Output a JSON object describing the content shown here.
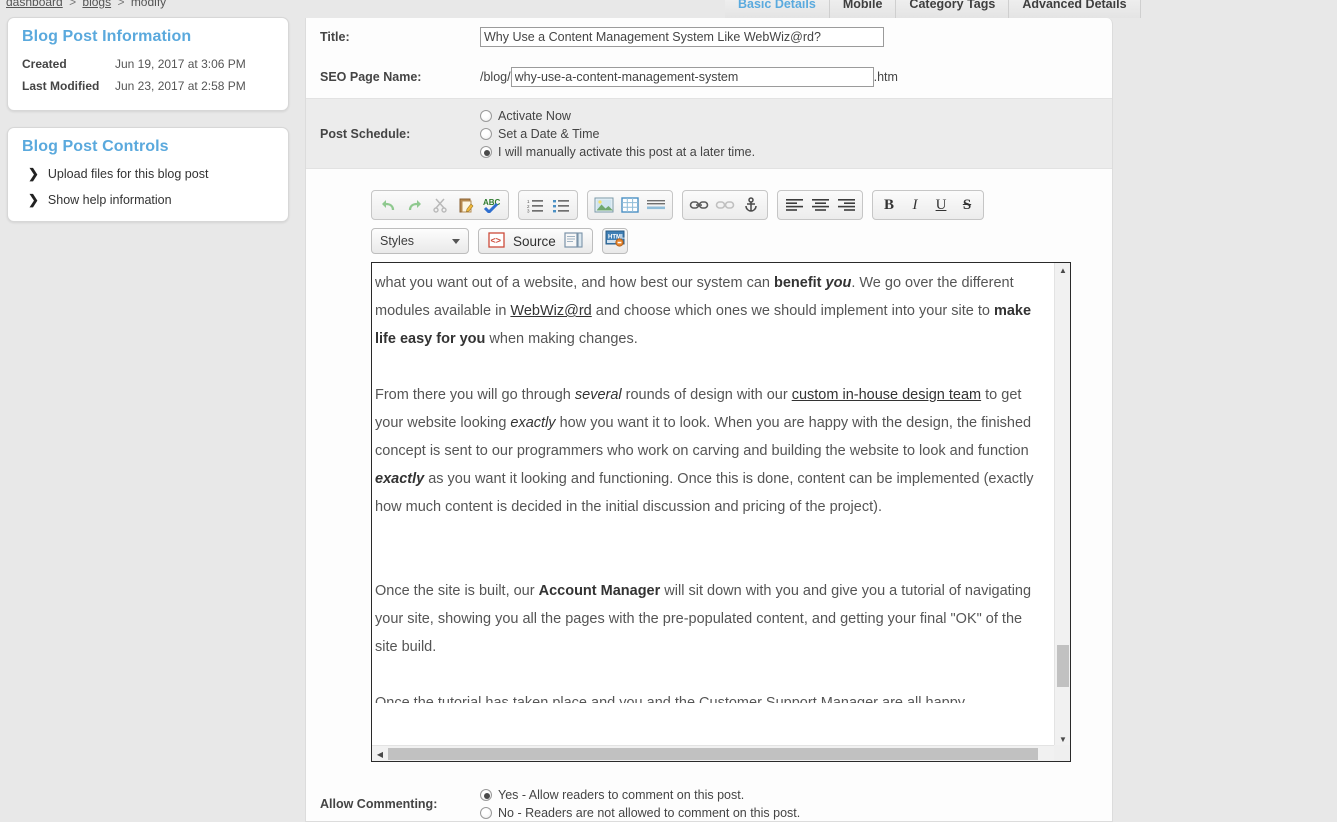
{
  "breadcrumb": {
    "items": [
      {
        "label": "dashboard",
        "link": true
      },
      {
        "label": "blogs",
        "link": true
      },
      {
        "label": "modify",
        "link": false
      }
    ],
    "separator": ">"
  },
  "sidebar": {
    "info_panel": {
      "title": "Blog Post Information",
      "rows": [
        {
          "label": "Created",
          "value": "Jun 19, 2017 at 3:06 PM"
        },
        {
          "label": "Last Modified",
          "value": "Jun 23, 2017 at 2:58 PM"
        }
      ]
    },
    "controls_panel": {
      "title": "Blog Post Controls",
      "items": [
        {
          "label": "Upload files for this blog post"
        },
        {
          "label": "Show help information"
        }
      ]
    }
  },
  "tabs": [
    {
      "label": "Basic Details",
      "active": true
    },
    {
      "label": "Mobile",
      "active": false
    },
    {
      "label": "Category Tags",
      "active": false
    },
    {
      "label": "Advanced Details",
      "active": false
    }
  ],
  "form": {
    "title_label": "Title:",
    "title_value": "Why Use a Content Management System Like WebWiz@rd?",
    "seo_label": "SEO Page Name:",
    "seo_prefix": "/blog/",
    "seo_value": "why-use-a-content-management-system",
    "seo_suffix": ".htm",
    "schedule_label": "Post Schedule:",
    "schedule_options": [
      {
        "label": "Activate Now",
        "selected": false
      },
      {
        "label": "Set a Date & Time",
        "selected": false
      },
      {
        "label": "I will manually activate this post at a later time.",
        "selected": true
      }
    ],
    "commenting_label": "Allow Commenting:",
    "commenting_options": [
      {
        "label": "Yes - Allow readers to comment on this post.",
        "selected": true
      },
      {
        "label": "No - Readers are not allowed to comment on this post.",
        "selected": false
      }
    ]
  },
  "editor": {
    "toolbar_row1": [
      {
        "group": 1,
        "icon": "undo-icon",
        "title": "Undo"
      },
      {
        "group": 1,
        "icon": "redo-icon",
        "title": "Redo"
      },
      {
        "group": 1,
        "icon": "cut-scissors-icon",
        "title": "Cut"
      },
      {
        "group": 1,
        "icon": "paste-icon",
        "title": "Paste"
      },
      {
        "group": 1,
        "icon": "spellcheck-abc-icon",
        "title": "Spell Check"
      },
      {
        "group": 2,
        "icon": "numbered-list-icon",
        "title": "Numbered List"
      },
      {
        "group": 2,
        "icon": "bulleted-list-icon",
        "title": "Bulleted List"
      },
      {
        "group": 3,
        "icon": "insert-image-icon",
        "title": "Insert Image"
      },
      {
        "group": 3,
        "icon": "insert-table-icon",
        "title": "Insert Table"
      },
      {
        "group": 3,
        "icon": "horizontal-rule-icon",
        "title": "Horizontal Rule"
      },
      {
        "group": 4,
        "icon": "link-icon",
        "title": "Insert Link"
      },
      {
        "group": 4,
        "icon": "unlink-icon",
        "title": "Remove Link"
      },
      {
        "group": 4,
        "icon": "anchor-icon",
        "title": "Anchor"
      },
      {
        "group": 5,
        "icon": "align-left-icon",
        "title": "Align Left"
      },
      {
        "group": 5,
        "icon": "align-center-icon",
        "title": "Align Center"
      },
      {
        "group": 5,
        "icon": "align-right-icon",
        "title": "Align Right"
      },
      {
        "group": 6,
        "icon": "bold-icon",
        "title": "Bold",
        "glyph": "B"
      },
      {
        "group": 6,
        "icon": "italic-icon",
        "title": "Italic",
        "glyph": "I"
      },
      {
        "group": 6,
        "icon": "underline-icon",
        "title": "Underline",
        "glyph": "U"
      },
      {
        "group": 6,
        "icon": "strikethrough-icon",
        "title": "Strikethrough",
        "glyph": "S"
      }
    ],
    "styles_label": "Styles",
    "source_label": "Source",
    "content_paragraphs": [
      {
        "id": "p1",
        "runs": [
          {
            "t": "what you want out of a website, and how best our system can ",
            "s": "n"
          },
          {
            "t": "benefit ",
            "s": "b"
          },
          {
            "t": "you",
            "s": "bi"
          },
          {
            "t": ". We go over the different modules available in ",
            "s": "n"
          },
          {
            "t": "WebWiz@rd",
            "s": "u"
          },
          {
            "t": " and choose which ones we should implement into your site to ",
            "s": "n"
          },
          {
            "t": "make life easy for you",
            "s": "b"
          },
          {
            "t": " when making changes.",
            "s": "n"
          }
        ]
      },
      {
        "id": "p2",
        "runs": [
          {
            "t": "From there you will go through ",
            "s": "n"
          },
          {
            "t": "several",
            "s": "i"
          },
          {
            "t": " rounds of design with our ",
            "s": "n"
          },
          {
            "t": "custom in-house design team",
            "s": "u"
          },
          {
            "t": " to get your website looking ",
            "s": "n"
          },
          {
            "t": "exactly",
            "s": "i"
          },
          {
            "t": " how you want it to look. When you are happy with the design, the finished concept is sent to our programmers who work on carving and building the website to look and function ",
            "s": "n"
          },
          {
            "t": "exactly",
            "s": "bi"
          },
          {
            "t": " as you want it looking and functioning. Once this is done, content can be implemented (exactly how much content is decided in the initial discussion and pricing of the project).",
            "s": "n"
          }
        ]
      },
      {
        "id": "p3",
        "runs": [
          {
            "t": "Once the site is built, our ",
            "s": "n"
          },
          {
            "t": "Account Manager",
            "s": "b"
          },
          {
            "t": " will sit down with you and give you a tutorial of navigating your site, showing you all the pages with the pre-populated content, and getting your final \"OK\" of the site build.",
            "s": "n"
          }
        ]
      },
      {
        "id": "p4-clipped",
        "runs": [
          {
            "t": "Once the tutorial has taken place and you and the Customer Support Manager are all happy,",
            "s": "n"
          }
        ]
      }
    ]
  },
  "colors": {
    "accent_blue": "#5aa9dd",
    "page_bg": "#e8e8e8",
    "panel_bg": "#ffffff",
    "row_alt_bg": "#ececec"
  }
}
